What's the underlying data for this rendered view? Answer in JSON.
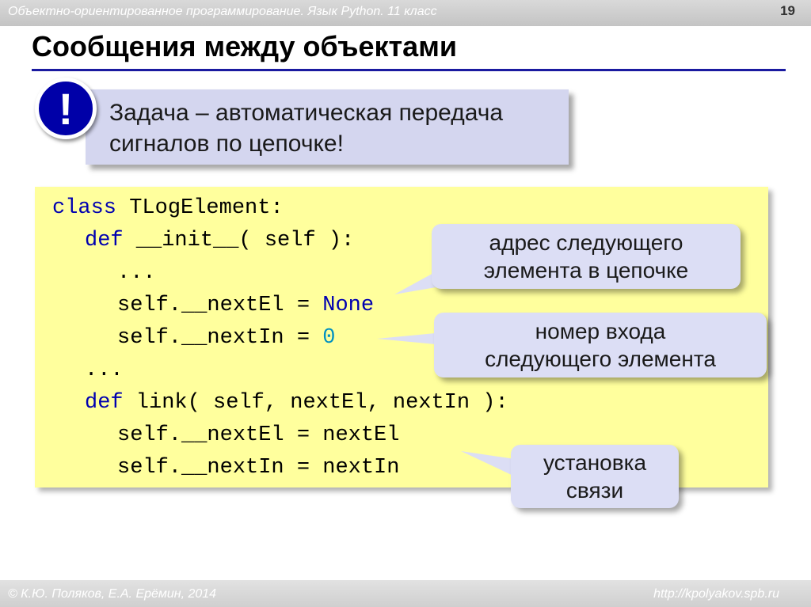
{
  "header": {
    "course_title": "Объектно-ориентированное программирование. Язык Python. 11 класс",
    "slide_number": "19"
  },
  "slide": {
    "title": "Сообщения между объектами"
  },
  "task": {
    "line1": "Задача – автоматическая передача",
    "line2": "сигналов по цепочке!"
  },
  "code": {
    "l1_kw": "class",
    "l1_rest": " TLogElement:",
    "l2_kw": "def",
    "l2_rest": " __init__( self ):",
    "l3": "...",
    "l4_pre": "self.__nextEl = ",
    "l4_val": "None",
    "l5_pre": "self.__nextIn = ",
    "l5_val": "0",
    "l6": "...",
    "l7_kw": "def",
    "l7_rest": " link( self, nextEl, nextIn ):",
    "l8": "self.__nextEl = nextEl",
    "l9": "self.__nextIn = nextIn"
  },
  "callouts": {
    "next_address": {
      "line1": "адрес следующего",
      "line2": "элемента в цепочке"
    },
    "input_number": {
      "line1": "номер входа",
      "line2": "следующего элемента"
    },
    "link_setup": {
      "line1": "установка",
      "line2": "связи"
    }
  },
  "footer": {
    "authors": "© К.Ю. Поляков, Е.А. Ерёмин, 2014",
    "url": "http://kpolyakov.spb.ru"
  },
  "colors": {
    "title_rule": "#1a1aa0",
    "alert_icon": "#0000a8",
    "code_background": "#ffff9d",
    "callout_background": "#dcdef5",
    "keyword": "#0000b0"
  }
}
